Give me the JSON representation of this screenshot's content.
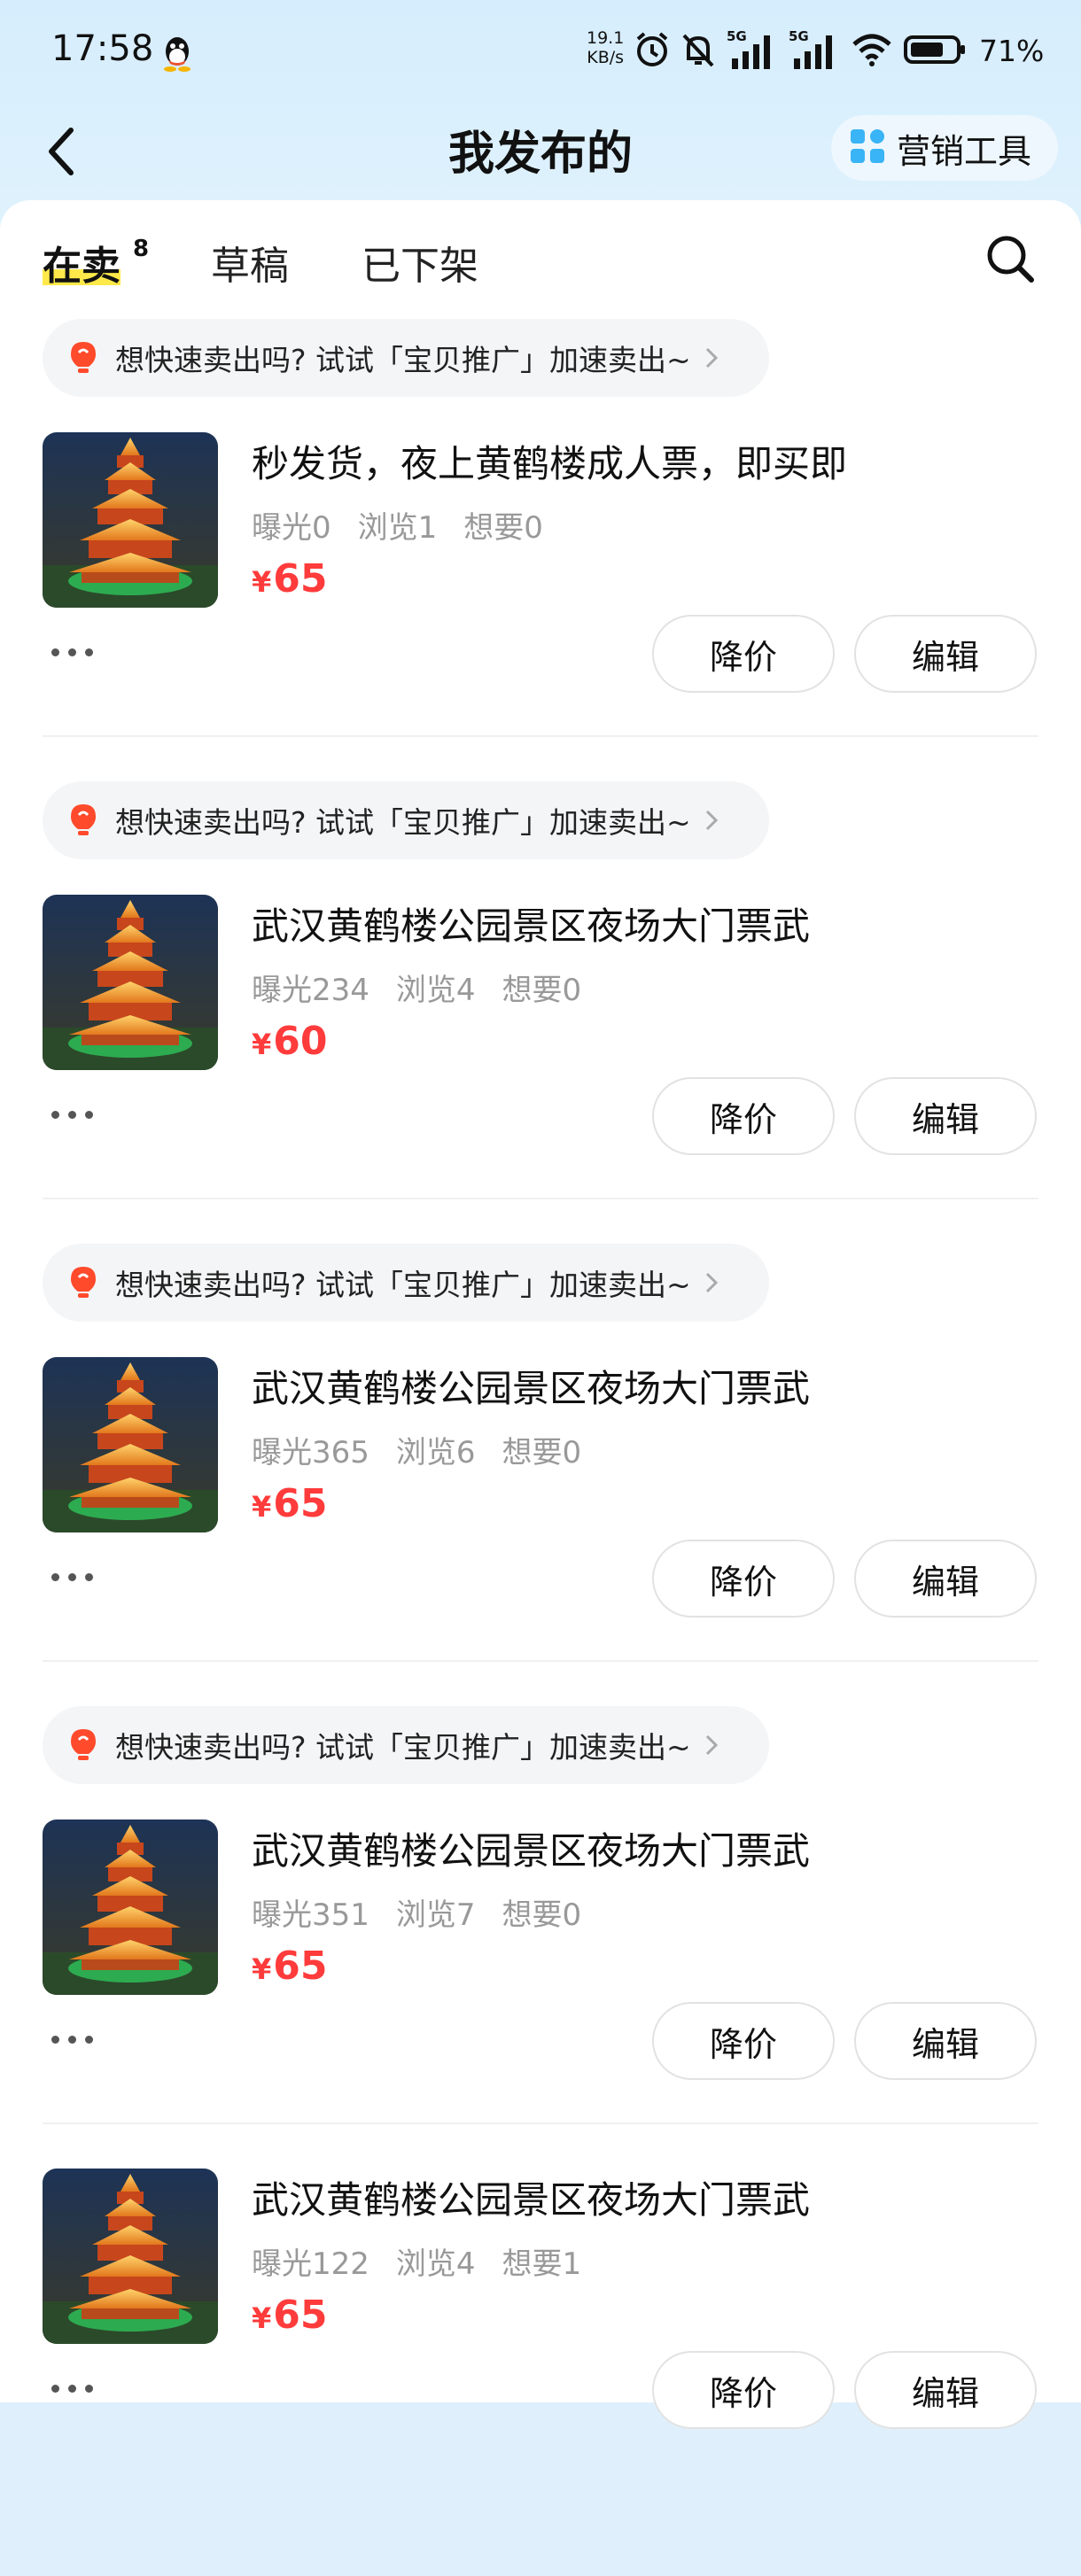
{
  "status_bar": {
    "time": "17:58",
    "net_speed_value": "19.1",
    "net_speed_unit": "KB/s",
    "battery": "71%",
    "icons": [
      "qq-icon",
      "alarm-icon",
      "mute-icon",
      "5g-signal-icon",
      "5g-signal-icon",
      "wifi-icon",
      "battery-icon"
    ]
  },
  "header": {
    "title": "我发布的",
    "tools_label": "营销工具"
  },
  "tabs": [
    {
      "label": "在卖",
      "count": "8",
      "active": true
    },
    {
      "label": "草稿"
    },
    {
      "label": "已下架"
    }
  ],
  "promo_text": "想快速卖出吗? 试试「宝贝推广」加速卖出~",
  "listings": [
    {
      "title": "秒发货，夜上黄鹤楼成人票，即买即",
      "stats": [
        "曝光0",
        "浏览1",
        "想要0"
      ],
      "currency": "¥",
      "price": "65",
      "actions": [
        "降价",
        "编辑"
      ]
    },
    {
      "title": "武汉黄鹤楼公园景区夜场大门票武",
      "stats": [
        "曝光234",
        "浏览4",
        "想要0"
      ],
      "currency": "¥",
      "price": "60",
      "actions": [
        "降价",
        "编辑"
      ]
    },
    {
      "title": "武汉黄鹤楼公园景区夜场大门票武",
      "stats": [
        "曝光365",
        "浏览6",
        "想要0"
      ],
      "currency": "¥",
      "price": "65",
      "actions": [
        "降价",
        "编辑"
      ]
    },
    {
      "title": "武汉黄鹤楼公园景区夜场大门票武",
      "stats": [
        "曝光351",
        "浏览7",
        "想要0"
      ],
      "currency": "¥",
      "price": "65",
      "actions": [
        "降价",
        "编辑"
      ]
    },
    {
      "title": "武汉黄鹤楼公园景区夜场大门票武",
      "stats": [
        "曝光122",
        "浏览4",
        "想要1"
      ],
      "currency": "¥",
      "price": "65",
      "actions": [
        "降价",
        "编辑"
      ]
    }
  ],
  "colors": {
    "price": "#ff3b3b",
    "tab_highlight": "#ffe94a",
    "header_bg": "#dff0fc"
  }
}
